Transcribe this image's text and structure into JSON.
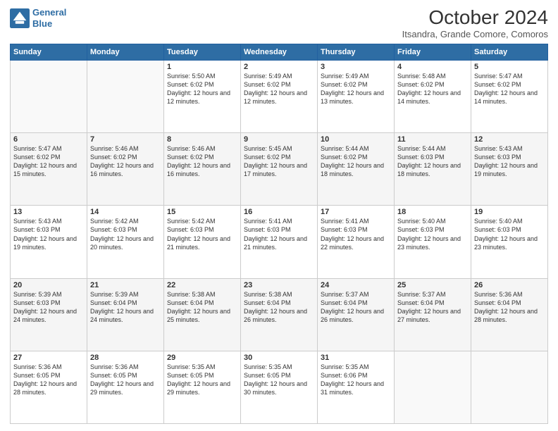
{
  "header": {
    "logo_line1": "General",
    "logo_line2": "Blue",
    "title": "October 2024",
    "subtitle": "Itsandra, Grande Comore, Comoros"
  },
  "days_of_week": [
    "Sunday",
    "Monday",
    "Tuesday",
    "Wednesday",
    "Thursday",
    "Friday",
    "Saturday"
  ],
  "weeks": [
    [
      {
        "day": "",
        "content": ""
      },
      {
        "day": "",
        "content": ""
      },
      {
        "day": "1",
        "content": "Sunrise: 5:50 AM\nSunset: 6:02 PM\nDaylight: 12 hours and 12 minutes."
      },
      {
        "day": "2",
        "content": "Sunrise: 5:49 AM\nSunset: 6:02 PM\nDaylight: 12 hours and 12 minutes."
      },
      {
        "day": "3",
        "content": "Sunrise: 5:49 AM\nSunset: 6:02 PM\nDaylight: 12 hours and 13 minutes."
      },
      {
        "day": "4",
        "content": "Sunrise: 5:48 AM\nSunset: 6:02 PM\nDaylight: 12 hours and 14 minutes."
      },
      {
        "day": "5",
        "content": "Sunrise: 5:47 AM\nSunset: 6:02 PM\nDaylight: 12 hours and 14 minutes."
      }
    ],
    [
      {
        "day": "6",
        "content": "Sunrise: 5:47 AM\nSunset: 6:02 PM\nDaylight: 12 hours and 15 minutes."
      },
      {
        "day": "7",
        "content": "Sunrise: 5:46 AM\nSunset: 6:02 PM\nDaylight: 12 hours and 16 minutes."
      },
      {
        "day": "8",
        "content": "Sunrise: 5:46 AM\nSunset: 6:02 PM\nDaylight: 12 hours and 16 minutes."
      },
      {
        "day": "9",
        "content": "Sunrise: 5:45 AM\nSunset: 6:02 PM\nDaylight: 12 hours and 17 minutes."
      },
      {
        "day": "10",
        "content": "Sunrise: 5:44 AM\nSunset: 6:02 PM\nDaylight: 12 hours and 18 minutes."
      },
      {
        "day": "11",
        "content": "Sunrise: 5:44 AM\nSunset: 6:03 PM\nDaylight: 12 hours and 18 minutes."
      },
      {
        "day": "12",
        "content": "Sunrise: 5:43 AM\nSunset: 6:03 PM\nDaylight: 12 hours and 19 minutes."
      }
    ],
    [
      {
        "day": "13",
        "content": "Sunrise: 5:43 AM\nSunset: 6:03 PM\nDaylight: 12 hours and 19 minutes."
      },
      {
        "day": "14",
        "content": "Sunrise: 5:42 AM\nSunset: 6:03 PM\nDaylight: 12 hours and 20 minutes."
      },
      {
        "day": "15",
        "content": "Sunrise: 5:42 AM\nSunset: 6:03 PM\nDaylight: 12 hours and 21 minutes."
      },
      {
        "day": "16",
        "content": "Sunrise: 5:41 AM\nSunset: 6:03 PM\nDaylight: 12 hours and 21 minutes."
      },
      {
        "day": "17",
        "content": "Sunrise: 5:41 AM\nSunset: 6:03 PM\nDaylight: 12 hours and 22 minutes."
      },
      {
        "day": "18",
        "content": "Sunrise: 5:40 AM\nSunset: 6:03 PM\nDaylight: 12 hours and 23 minutes."
      },
      {
        "day": "19",
        "content": "Sunrise: 5:40 AM\nSunset: 6:03 PM\nDaylight: 12 hours and 23 minutes."
      }
    ],
    [
      {
        "day": "20",
        "content": "Sunrise: 5:39 AM\nSunset: 6:03 PM\nDaylight: 12 hours and 24 minutes."
      },
      {
        "day": "21",
        "content": "Sunrise: 5:39 AM\nSunset: 6:04 PM\nDaylight: 12 hours and 24 minutes."
      },
      {
        "day": "22",
        "content": "Sunrise: 5:38 AM\nSunset: 6:04 PM\nDaylight: 12 hours and 25 minutes."
      },
      {
        "day": "23",
        "content": "Sunrise: 5:38 AM\nSunset: 6:04 PM\nDaylight: 12 hours and 26 minutes."
      },
      {
        "day": "24",
        "content": "Sunrise: 5:37 AM\nSunset: 6:04 PM\nDaylight: 12 hours and 26 minutes."
      },
      {
        "day": "25",
        "content": "Sunrise: 5:37 AM\nSunset: 6:04 PM\nDaylight: 12 hours and 27 minutes."
      },
      {
        "day": "26",
        "content": "Sunrise: 5:36 AM\nSunset: 6:04 PM\nDaylight: 12 hours and 28 minutes."
      }
    ],
    [
      {
        "day": "27",
        "content": "Sunrise: 5:36 AM\nSunset: 6:05 PM\nDaylight: 12 hours and 28 minutes."
      },
      {
        "day": "28",
        "content": "Sunrise: 5:36 AM\nSunset: 6:05 PM\nDaylight: 12 hours and 29 minutes."
      },
      {
        "day": "29",
        "content": "Sunrise: 5:35 AM\nSunset: 6:05 PM\nDaylight: 12 hours and 29 minutes."
      },
      {
        "day": "30",
        "content": "Sunrise: 5:35 AM\nSunset: 6:05 PM\nDaylight: 12 hours and 30 minutes."
      },
      {
        "day": "31",
        "content": "Sunrise: 5:35 AM\nSunset: 6:06 PM\nDaylight: 12 hours and 31 minutes."
      },
      {
        "day": "",
        "content": ""
      },
      {
        "day": "",
        "content": ""
      }
    ]
  ]
}
